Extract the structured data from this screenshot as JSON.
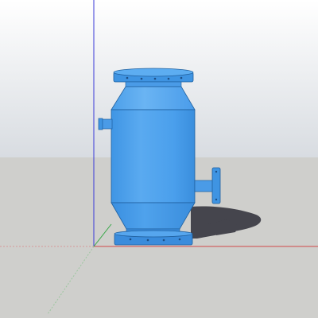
{
  "viewport": {
    "model_icon": "pressure-vessel-icon",
    "colors": {
      "sky_top": "#ffffff",
      "sky_bottom": "#d9dde2",
      "ground": "#cfcfcc",
      "body_light": "#5aaaf0",
      "body_mid": "#3c93e3",
      "body_dark": "#2a78c8",
      "flange": "#4f9fea",
      "shadow": "#404048",
      "axis_red": "#d04a4a",
      "axis_green": "#3aa84a",
      "axis_blue": "#3a3ad8"
    }
  }
}
